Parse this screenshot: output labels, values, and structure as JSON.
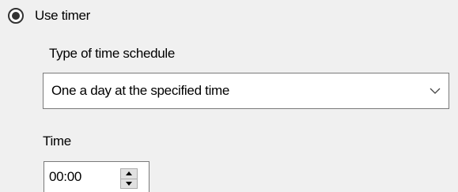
{
  "timer_option": {
    "label": "Use timer",
    "selected": true
  },
  "schedule": {
    "label": "Type of time schedule",
    "selected_value": "One a day at the specified time",
    "arrow_icon": "chevron-down-icon"
  },
  "time": {
    "label": "Time",
    "value": "00:00",
    "up_icon": "spin-up-icon",
    "down_icon": "spin-down-icon"
  }
}
